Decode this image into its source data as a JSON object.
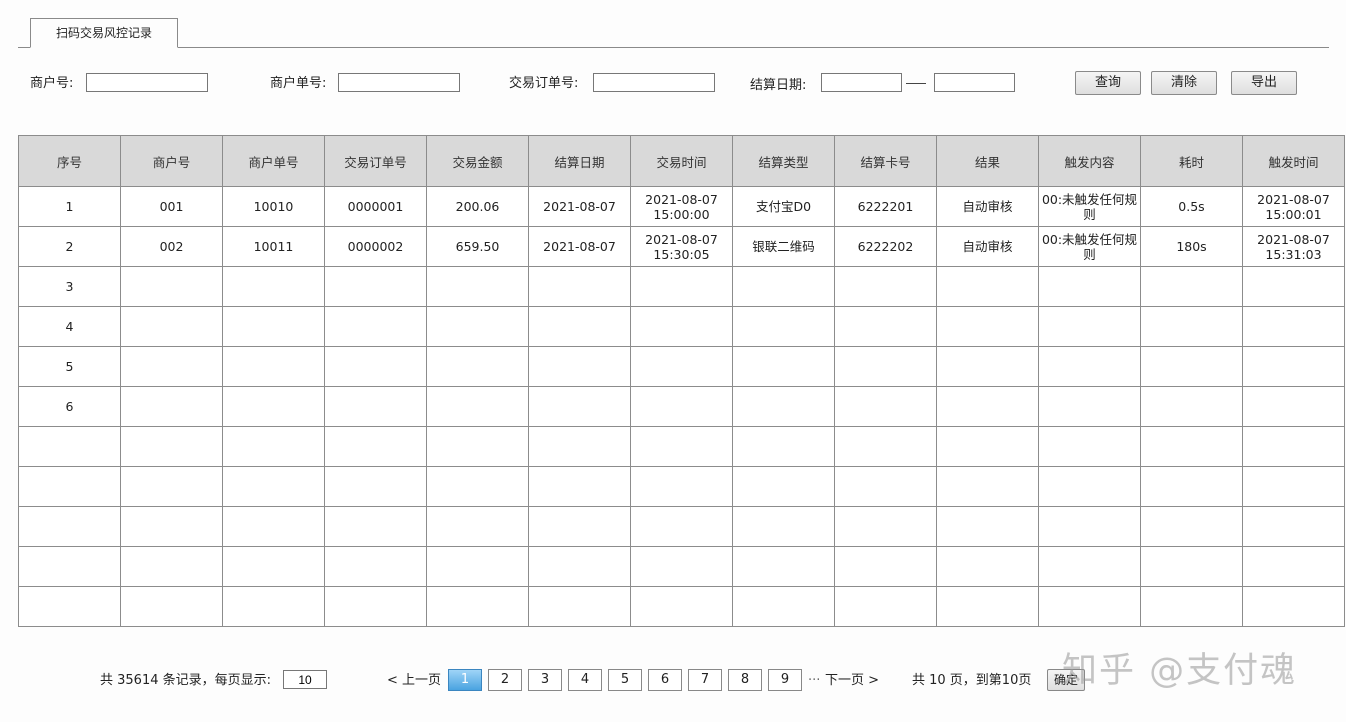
{
  "tab": {
    "label": "扫码交易风控记录"
  },
  "filters": {
    "merchant_no_label": "商户号:",
    "merchant_order_label": "商户单号:",
    "trade_order_label": "交易订单号:",
    "settle_date_label": "结算日期:",
    "merchant_no_value": "",
    "merchant_order_value": "",
    "trade_order_value": "",
    "settle_date_from": "",
    "settle_date_to": ""
  },
  "buttons": {
    "query": "查询",
    "clear": "清除",
    "export": "导出"
  },
  "table": {
    "headers": [
      "序号",
      "商户号",
      "商户单号",
      "交易订单号",
      "交易金额",
      "结算日期",
      "交易时间",
      "结算类型",
      "结算卡号",
      "结果",
      "触发内容",
      "耗时",
      "触发时间"
    ],
    "rows": [
      [
        "1",
        "001",
        "10010",
        "0000001",
        "200.06",
        "2021-08-07",
        "2021-08-07 15:00:00",
        "支付宝D0",
        "6222201",
        "自动审核",
        "00:未触发任何规则",
        "0.5s",
        "2021-08-07 15:00:01"
      ],
      [
        "2",
        "002",
        "10011",
        "0000002",
        "659.50",
        "2021-08-07",
        "2021-08-07 15:30:05",
        "银联二维码",
        "6222202",
        "自动审核",
        "00:未触发任何规则",
        "180s",
        "2021-08-07 15:31:03"
      ],
      [
        "3",
        "",
        "",
        "",
        "",
        "",
        "",
        "",
        "",
        "",
        "",
        "",
        ""
      ],
      [
        "4",
        "",
        "",
        "",
        "",
        "",
        "",
        "",
        "",
        "",
        "",
        "",
        ""
      ],
      [
        "5",
        "",
        "",
        "",
        "",
        "",
        "",
        "",
        "",
        "",
        "",
        "",
        ""
      ],
      [
        "6",
        "",
        "",
        "",
        "",
        "",
        "",
        "",
        "",
        "",
        "",
        "",
        ""
      ],
      [
        "",
        "",
        "",
        "",
        "",
        "",
        "",
        "",
        "",
        "",
        "",
        "",
        ""
      ],
      [
        "",
        "",
        "",
        "",
        "",
        "",
        "",
        "",
        "",
        "",
        "",
        "",
        ""
      ],
      [
        "",
        "",
        "",
        "",
        "",
        "",
        "",
        "",
        "",
        "",
        "",
        "",
        ""
      ],
      [
        "",
        "",
        "",
        "",
        "",
        "",
        "",
        "",
        "",
        "",
        "",
        "",
        ""
      ],
      [
        "",
        "",
        "",
        "",
        "",
        "",
        "",
        "",
        "",
        "",
        "",
        "",
        ""
      ]
    ]
  },
  "pager": {
    "summary_prefix": "共 35614 条记录，每页显示:",
    "page_size": "10",
    "prev": "< 上一页",
    "pages": [
      "1",
      "2",
      "3",
      "4",
      "5",
      "6",
      "7",
      "8",
      "9"
    ],
    "current_page": "1",
    "ellipsis": "···",
    "next": "下一页 >",
    "total": "共 10 页，到第10页",
    "go": "确定"
  },
  "watermark": "知乎 @支付魂"
}
